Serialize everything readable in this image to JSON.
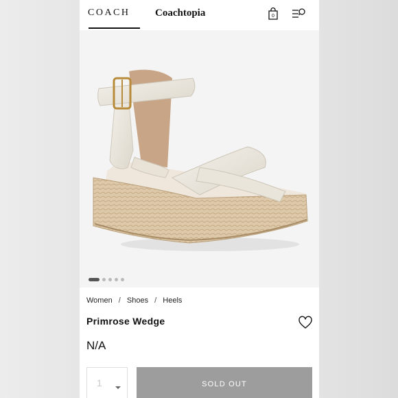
{
  "header": {
    "brand_logo": "COACH",
    "sub_brand": "Coachtopia",
    "bag_icon": "shopping-bag-icon",
    "menu_icon": "menu-search-icon",
    "bag_count": "0"
  },
  "gallery": {
    "image": "espadrille-wedge-sandal",
    "dots_count": 5,
    "active_index": 0
  },
  "breadcrumb": {
    "items": [
      "Women",
      "Shoes",
      "Heels"
    ],
    "separator": "/"
  },
  "product": {
    "name": "Primrose Wedge",
    "price": "N/A",
    "wishlist_icon": "heart-outline-icon"
  },
  "purchase": {
    "quantity": "1",
    "sold_out_label": "SOLD OUT"
  },
  "colors": {
    "sold_out_bg": "#9d9d9d",
    "strap": "#ece8df",
    "jute": "#d9c4a4"
  }
}
